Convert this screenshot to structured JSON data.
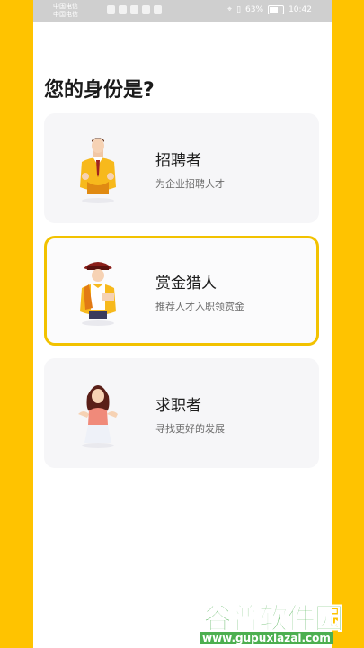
{
  "status_bar": {
    "carrier_line1": "中国电信",
    "carrier_line2": "中国电信",
    "battery_text": "63%",
    "battery_level": 0.63,
    "time": "10:42"
  },
  "page": {
    "title": "您的身份是?"
  },
  "roles": [
    {
      "name": "招聘者",
      "description": "为企业招聘人才",
      "selected": false,
      "icon": "businessman-icon"
    },
    {
      "name": "赏金猎人",
      "description": "推荐人才入职领赏金",
      "selected": true,
      "icon": "bounty-hunter-icon"
    },
    {
      "name": "求职者",
      "description": "寻找更好的发展",
      "selected": false,
      "icon": "job-seeker-icon"
    }
  ],
  "watermark": {
    "brand": "谷普软件园",
    "url": "www.gupuxiazai.com"
  },
  "colors": {
    "accent": "#FFC300",
    "selected_border": "#F2C200",
    "card_bg": "#F6F6F8"
  }
}
